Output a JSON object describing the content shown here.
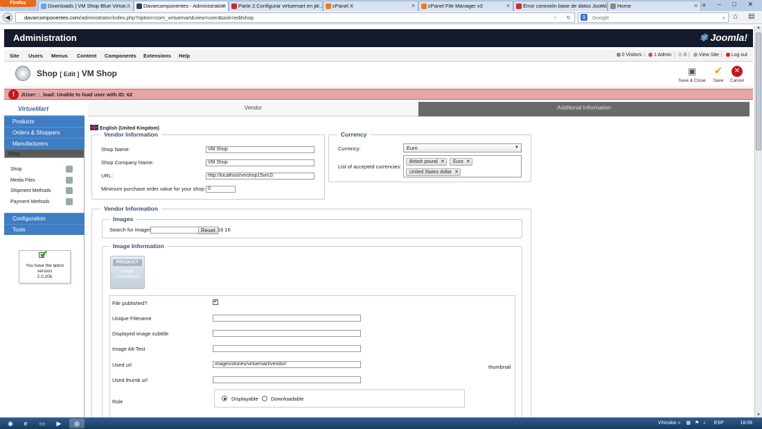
{
  "browser": {
    "app_button": "Firefox",
    "tabs": [
      {
        "label": "Downloads | VM Shop Blue Virtue...",
        "color": "#6aa3d8"
      },
      {
        "label": "Davarcomponentes - Administration",
        "color": "#2e3d67"
      },
      {
        "label": "Parte 2.Configurar virtuemart en jo...",
        "color": "#cc2b2b"
      },
      {
        "label": "cPanel X",
        "color": "#f07b21"
      },
      {
        "label": "cPanel File Manager v3",
        "color": "#f07b21"
      },
      {
        "label": "Error conexión base de datos Joomla...",
        "color": "#cc2b2b"
      },
      {
        "label": "Home",
        "color": "#888888"
      }
    ],
    "new_tab": "+",
    "url_host": "davarcomponentes.com",
    "url_path": "/administrator/index.php?option=com_virtuemart&view=user&task=editshop",
    "search_placeholder": "Google",
    "window_controls": "– □ ✕"
  },
  "joomla": {
    "header_title": "Administration",
    "logo_text": "Joomla!",
    "menu": [
      "Site",
      "Users",
      "Menus",
      "Content",
      "Components",
      "Extensions",
      "Help"
    ],
    "status": {
      "visitors": "0 Visitors",
      "admin": "1 Admin",
      "messages": "0",
      "view_site": "View Site",
      "logout": "Log out"
    },
    "page_title": "Shop",
    "page_edit": "[ Edit ]",
    "page_subtitle": "VM Shop",
    "toolbar": {
      "save_close": "Save & Close",
      "save": "Save",
      "cancel": "Cancel"
    },
    "error": "JUser: :_load: Unable to load user with ID: 62"
  },
  "sidebar": {
    "logo": "VirtueMart",
    "groups": [
      "Products",
      "Orders & Shoppers",
      "Manufacturers",
      "Shop",
      "Configuration",
      "Tools"
    ],
    "shop_items": [
      "Shop",
      "Media Files",
      "Shipment Methods",
      "Payment Methods"
    ],
    "version_box": {
      "line1": "You have the latest",
      "line2": "version",
      "line3": "2.0.20b"
    }
  },
  "main": {
    "tabs": {
      "vendor": "Vendor",
      "additional": "Additional Information"
    },
    "language": "English (United Kingdom)",
    "vendor_info": {
      "legend": "Vendor Information",
      "shop_name_label": "Shop Name:",
      "shop_name": "VM Shop",
      "company_label": "Shop Company Name:",
      "company": "VM Shop",
      "url_label": "URL:",
      "url": "http://localhost/vmshop15vm2/",
      "min_order_label": "Minimum purchase order value for your shop:",
      "min_order": "0"
    },
    "currency": {
      "legend": "Currency",
      "currency_label": "Currency:",
      "currency_value": "Euro",
      "accepted_label": "List of accepted currencies:",
      "accepted": [
        "British pound",
        "Euro",
        "United States dollar"
      ]
    },
    "vendor_info2": {
      "legend": "Vendor Information",
      "images_legend": "Images",
      "search_label": "Search for images",
      "reset": "Reset",
      "count": "16 16",
      "image_info_legend": "Image Information",
      "placeholder_top": "PRODUCT",
      "placeholder_bottom": "Image Unavailable"
    },
    "file_form": {
      "published_label": "File published?",
      "published": "✔",
      "unique_label": "Unique Filename",
      "unique": "",
      "subtitle_label": "Displayed image subtitle",
      "subtitle": "",
      "alt_label": "Image Alt-Text",
      "alt": "",
      "url_label": "Used url",
      "url": "images/stories/virtuemart/vendor/",
      "thumb_label": "Used thumb url",
      "thumb": "",
      "thumbnail": "thumbnail",
      "role_label": "Role",
      "role_displayable": "Displayable",
      "role_downloadable": "Downloadable"
    }
  },
  "taskbar": {
    "links": "Vínculos",
    "lang": "ESP",
    "time": "18:09"
  }
}
